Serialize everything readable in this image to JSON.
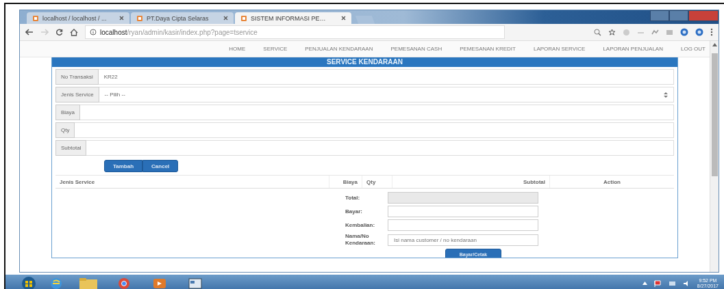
{
  "browser": {
    "tabs": [
      {
        "title": "localhost / localhost / ...",
        "selected": false
      },
      {
        "title": "PT.Daya Cipta Selaras",
        "selected": false
      },
      {
        "title": "SISTEM INFORMASI PE…",
        "selected": true
      }
    ],
    "url_host": "localhost",
    "url_path": "/ryan/admin/kasir/index.php?page=tservice"
  },
  "nav": [
    "HOME",
    "SERVICE",
    "PENJUALAN KENDARAAN",
    "PEMESANAN CASH",
    "PEMESANAN KREDIT",
    "LAPORAN SERVICE",
    "LAPORAN PENJUALAN",
    "LOG OUT"
  ],
  "panel": {
    "title": "SERVICE KENDARAAN",
    "fields": [
      {
        "label": "No Transaksi",
        "kind": "text",
        "value": "KR22"
      },
      {
        "label": "Jenis Service",
        "kind": "select",
        "value": "-- Pilih --"
      },
      {
        "label": "Biaya",
        "kind": "text"
      },
      {
        "label": "Qty",
        "kind": "text"
      },
      {
        "label": "Subtotal",
        "kind": "text"
      }
    ],
    "buttons": [
      "Tambah",
      "Cancel"
    ]
  },
  "table": {
    "columns": [
      "Jenis Service",
      "Biaya",
      "Qty",
      "Subtotal",
      "Action"
    ]
  },
  "payment": {
    "rows": [
      {
        "label": "Total:",
        "kind": "readonly"
      },
      {
        "label": "Bayar:",
        "kind": "input"
      },
      {
        "label": "Kembalian:",
        "kind": "input"
      },
      {
        "label": "Nama/No Kendaraan:",
        "kind": "input",
        "placeholder": "Isi nama customer / no kendaraan"
      }
    ],
    "button": "Bayar/Cetak"
  },
  "taskbar": {
    "time": "9:52 PM",
    "date": "8/27/2017"
  }
}
